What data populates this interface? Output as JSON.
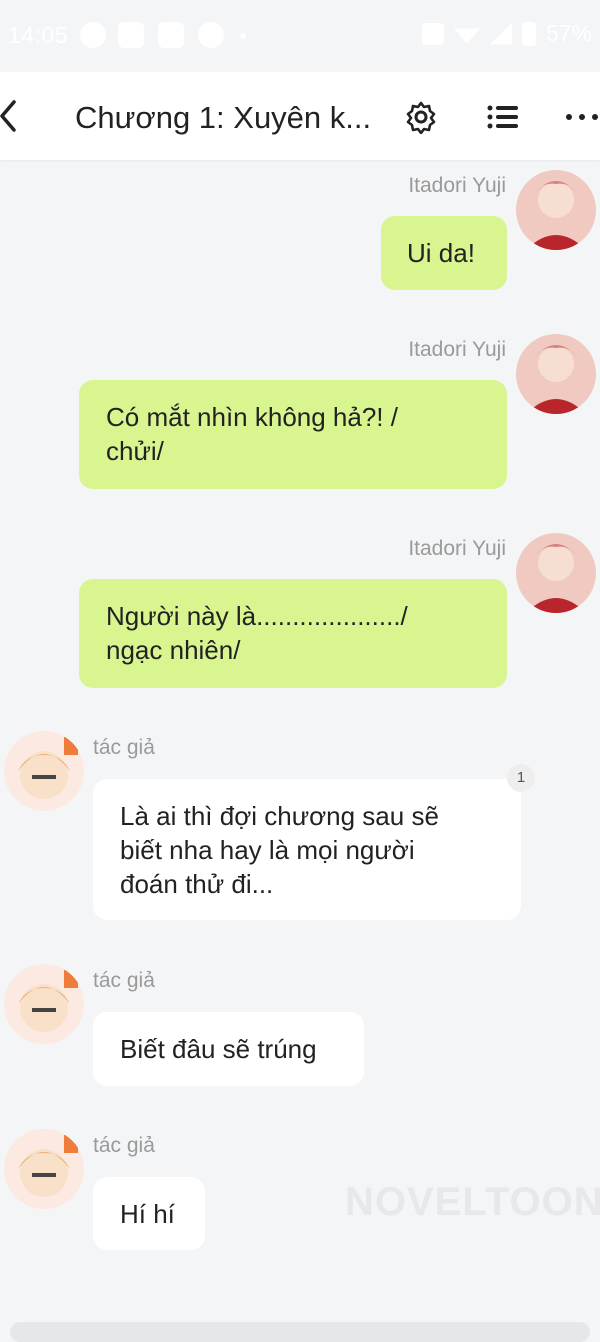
{
  "status_bar": {
    "time": "14:05",
    "battery": "57%",
    "left_icons": [
      "messenger-icon",
      "play-icon",
      "h-icon",
      "sync-icon"
    ],
    "right_icons": [
      "vibrate-icon",
      "wifi-icon",
      "signal-icon",
      "battery-icon"
    ]
  },
  "header": {
    "title": "Chương 1: Xuyên k...",
    "icons": [
      "back-icon",
      "settings-icon",
      "list-icon",
      "more-icon"
    ]
  },
  "messages": [
    {
      "sender": "Itadori Yuji",
      "side": "right",
      "text": "Ui da!"
    },
    {
      "sender": "Itadori Yuji",
      "side": "right",
      "text": "Có mắt nhìn không hả?! /\nchửi/"
    },
    {
      "sender": "Itadori Yuji",
      "side": "right",
      "text": "Người này là..................../\nngạc nhiên/"
    },
    {
      "sender": "tác giả",
      "side": "left",
      "text": "Là ai thì đợi chương sau sẽ\nbiết nha hay là mọi người\nđoán thử đi...",
      "badge": "1"
    },
    {
      "sender": "tác giả",
      "side": "left",
      "text": "Biết đâu sẽ trúng"
    },
    {
      "sender": "tác giả",
      "side": "left",
      "text": "Hí hí"
    }
  ],
  "watermark": "NOVELTOON",
  "colors": {
    "background": "#f4f5f7",
    "user_bubble": "#d8f590",
    "author_bubble": "#ffffff"
  }
}
